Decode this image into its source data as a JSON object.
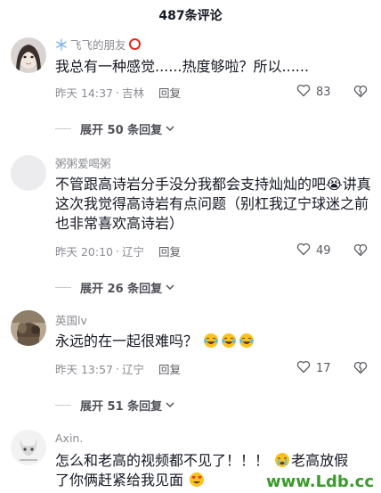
{
  "header": {
    "title": "487条评论"
  },
  "comments": [
    {
      "username": "飞飞的朋友",
      "text": "我总有一种感觉......热度够啦？所以......",
      "time": "昨天 14:37",
      "location": "吉林",
      "reply_label": "回复",
      "likes": "83",
      "expand_label": "展开 50 条回复"
    },
    {
      "username": "粥粥爱喝粥",
      "text": "不管跟高诗岩分手没分我都会支持灿灿的吧😭讲真这次我觉得高诗岩有点问题（别杠我辽宁球迷之前也非常喜欢高诗岩）",
      "time": "昨天 20:10",
      "location": "辽宁",
      "reply_label": "回复",
      "likes": "49",
      "expand_label": "展开 26 条回复"
    },
    {
      "username": "英国lv",
      "text": "永远的在一起很难吗？",
      "time": "昨天 13:57",
      "location": "辽宁",
      "reply_label": "回复",
      "likes": "17",
      "expand_label": "展开 51 条回复"
    },
    {
      "username": "Axin.",
      "text_line1": "怎么和老高的视频都不见了！！！",
      "text_line1_tail": "老高放假",
      "text_line2": "了你俩赶紧给我见面"
    }
  ],
  "watermark": "www.Ldb.cc",
  "colors": {
    "primary_text": "#161823",
    "secondary_text": "#8a8b91",
    "badge_red": "#e8281f",
    "watermark_green": "#3a9a2a"
  },
  "icons": {
    "like": "heart-outline-icon",
    "dislike": "broken-heart-icon",
    "expand": "chevron-down-icon"
  }
}
